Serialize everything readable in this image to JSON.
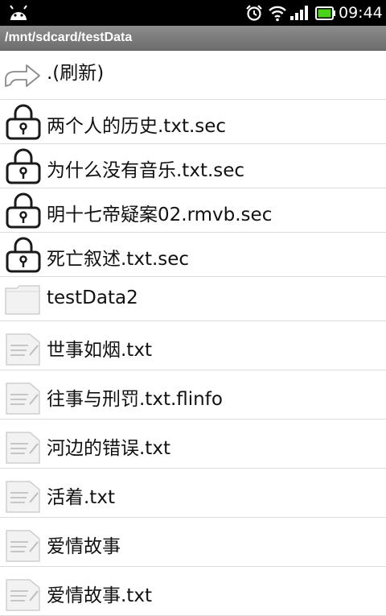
{
  "status_bar": {
    "time": "09:44",
    "icons": [
      "android-icon",
      "alarm-icon",
      "wifi-icon",
      "signal-icon",
      "battery-icon"
    ],
    "battery_color": "#4ad11a"
  },
  "path_bar": {
    "path": "/mnt/sdcard/testData"
  },
  "files": [
    {
      "name": ".(刷新)",
      "icon": "refresh-arrow-icon"
    },
    {
      "name": "两个人的历史.txt.sec",
      "icon": "lock-icon"
    },
    {
      "name": "为什么没有音乐.txt.sec",
      "icon": "lock-icon"
    },
    {
      "name": "明十七帝疑案02.rmvb.sec",
      "icon": "lock-icon"
    },
    {
      "name": "死亡叙述.txt.sec",
      "icon": "lock-icon"
    },
    {
      "name": "testData2",
      "icon": "folder-icon"
    },
    {
      "name": "世事如烟.txt",
      "icon": "text-file-icon"
    },
    {
      "name": "往事与刑罚.txt.flinfo",
      "icon": "text-file-icon"
    },
    {
      "name": "河边的错误.txt",
      "icon": "text-file-icon"
    },
    {
      "name": "活着.txt",
      "icon": "text-file-icon"
    },
    {
      "name": "爱情故事",
      "icon": "text-file-icon"
    },
    {
      "name": "爱情故事.txt",
      "icon": "text-file-icon"
    }
  ]
}
